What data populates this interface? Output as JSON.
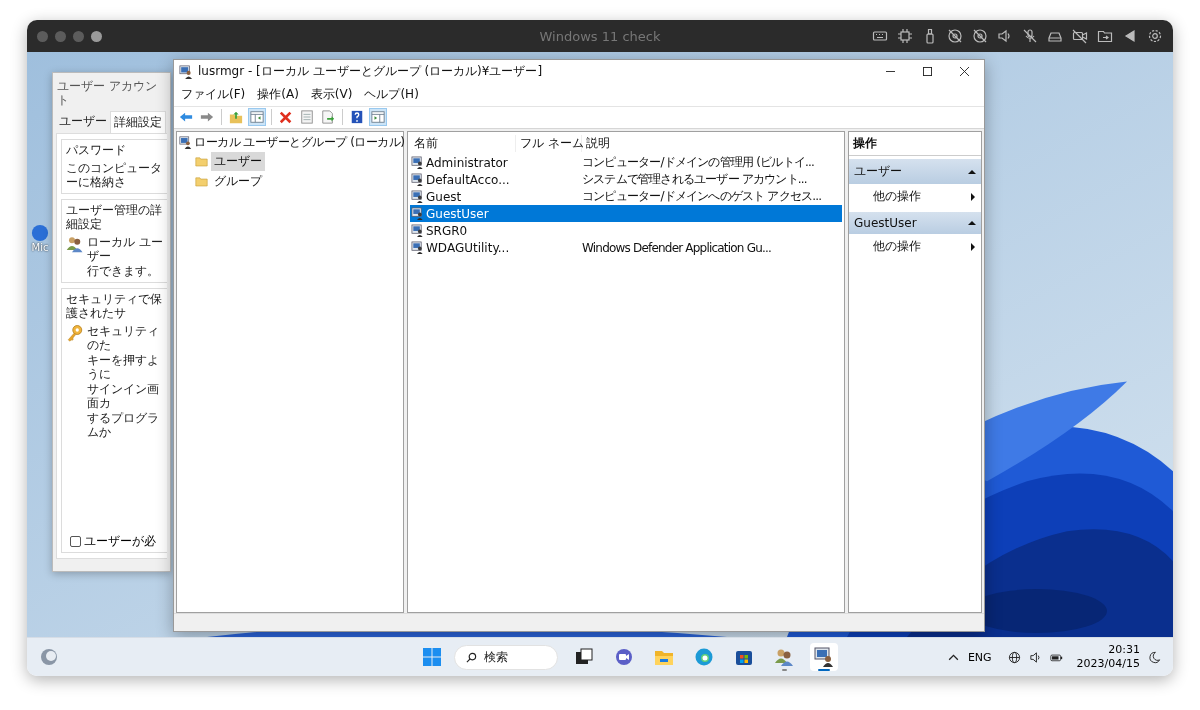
{
  "host_window": {
    "title": "Windows 11 check"
  },
  "desktop_icons": [
    {
      "label": "Mic"
    }
  ],
  "account_window": {
    "title": "ユーザー アカウント",
    "tabs": [
      {
        "label": "ユーザー",
        "selected": false
      },
      {
        "label": "詳細設定",
        "selected": true
      }
    ],
    "groups": [
      {
        "title": "パスワード",
        "lines": [
          "このコンピューターに格納さ"
        ]
      },
      {
        "title": "ユーザー管理の詳細設定",
        "lines": [
          "ローカル ユーザー",
          "行できます。"
        ]
      },
      {
        "title": "セキュリティで保護されたサ",
        "lines": [
          "セキュリティのた",
          "キーを押すように",
          "サインイン画面カ",
          "するプログラムか"
        ],
        "checkbox": {
          "label": "ユーザーが必",
          "checked": false
        }
      }
    ]
  },
  "mmc_window": {
    "title": "lusrmgr - [ローカル ユーザーとグループ (ローカル)¥ユーザー]",
    "menu": [
      "ファイル(F)",
      "操作(A)",
      "表示(V)",
      "ヘルプ(H)"
    ],
    "toolbar": [
      {
        "kind": "back",
        "pressed": false
      },
      {
        "kind": "forward",
        "pressed": false
      },
      {
        "kind": "up",
        "pressed": false
      },
      {
        "kind": "tree",
        "pressed": true
      },
      {
        "kind": "delete",
        "pressed": false
      },
      {
        "kind": "properties",
        "pressed": false
      },
      {
        "kind": "export",
        "pressed": false
      },
      {
        "kind": "help",
        "pressed": false
      },
      {
        "kind": "action_pane",
        "pressed": true
      }
    ],
    "tree": {
      "label": "ローカル ユーザーとグループ (ローカル)",
      "children": [
        {
          "label": "ユーザー",
          "selected": true
        },
        {
          "label": "グループ",
          "selected": false
        }
      ]
    },
    "table": {
      "columns": [
        "名前",
        "フル ネーム",
        "説明"
      ],
      "rows": [
        {
          "name": "Administrator",
          "description": "コンピューター/ドメインの管理用 (ビルトイ...",
          "selected": false
        },
        {
          "name": "DefaultAcco...",
          "description": "システムで管理されるユーザー アカウント...",
          "selected": false
        },
        {
          "name": "Guest",
          "description": "コンピューター/ドメインへのゲスト アクセス...",
          "selected": false
        },
        {
          "name": "GuestUser",
          "selected": true
        },
        {
          "name": "SRGR0",
          "selected": false
        },
        {
          "name": "WDAGUtility...",
          "description": "Windows Defender Application Gu...",
          "selected": false
        }
      ]
    },
    "actions": {
      "title": "操作",
      "sections": [
        {
          "title": "ユーザー",
          "items": [
            "他の操作"
          ]
        },
        {
          "title": "GuestUser",
          "items": [
            "他の操作"
          ]
        }
      ]
    }
  },
  "taskbar": {
    "search": {
      "placeholder": "検索"
    },
    "apps": [
      {
        "kind": "task_view",
        "running": false,
        "active": false
      },
      {
        "kind": "chat",
        "running": false,
        "active": false
      },
      {
        "kind": "explorer",
        "running": false,
        "active": false
      },
      {
        "kind": "edge",
        "running": false,
        "active": false
      },
      {
        "kind": "store",
        "running": false,
        "active": false
      },
      {
        "kind": "users",
        "running": true,
        "active": false
      },
      {
        "kind": "lusrmgr",
        "running": true,
        "active": true
      }
    ],
    "language": "ENG",
    "time": "20:31",
    "date": "2023/04/15"
  }
}
